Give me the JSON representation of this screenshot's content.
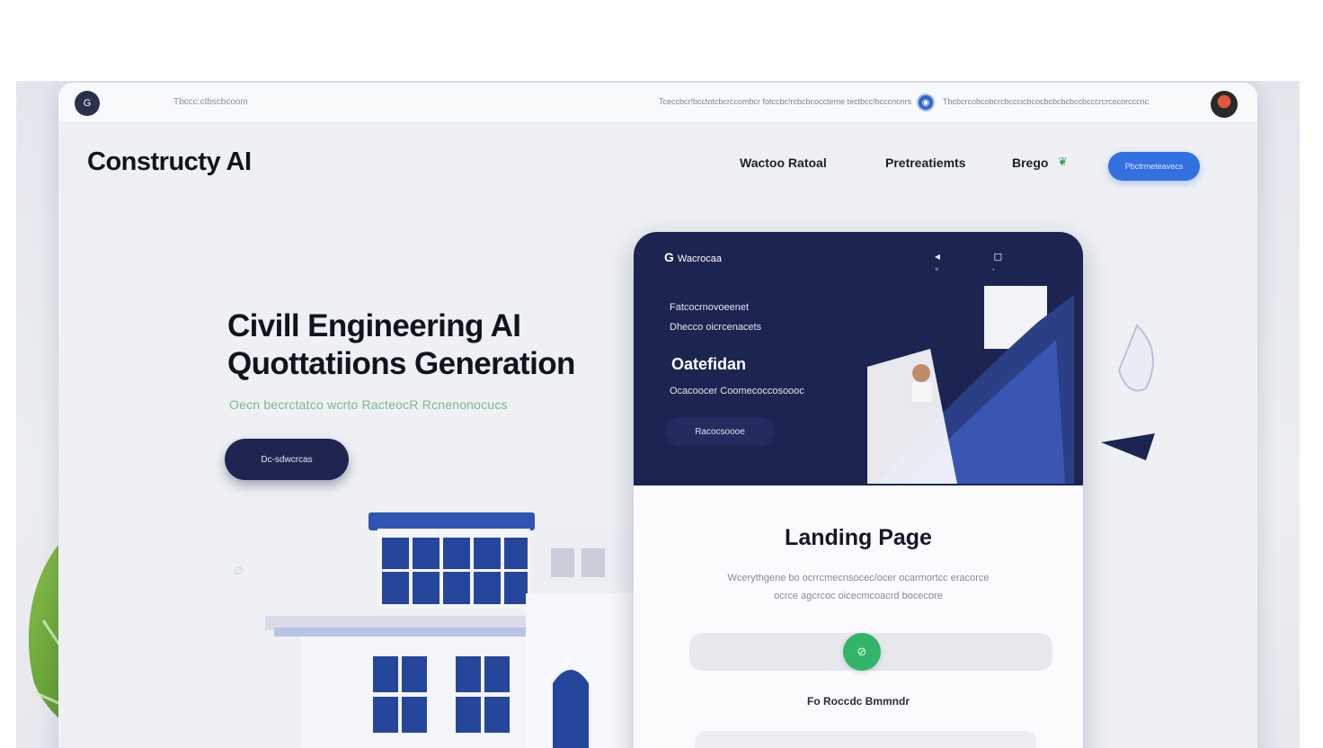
{
  "browser": {
    "logo_glyph": "G",
    "address": "Tbccc:ctbscbcoom",
    "url_left": "Tceccbcr!bcctotcbcrccombcr fotccbc!rcbcbcoccteme tectbcc!bcccncnrs",
    "url_right": "Tbcbcrcobcobcrcbcccicbcocbcbcbcbccbcccrcrcocorcccnc"
  },
  "header": {
    "brand": "Constructy AI",
    "nav": [
      "Wactoo Ratoal",
      "Pretreatiemts",
      "Brego"
    ],
    "cta": "Pbctrmeteavecs"
  },
  "hero": {
    "title_line1": "Civill Engineering AI",
    "title_line2": "Quottatiions Generation",
    "subtitle": "Oecn becrctatco wcrto RacteocR Rcnenonocucs",
    "cta": "Dc-sdwcrcas"
  },
  "phone": {
    "logo_glyph": "G",
    "logo_text": "Wacrocaa",
    "top_icons": "◂ ◻ ◦ ∙",
    "line1": "Fatcocrnovoeenet",
    "line2": "Dhecco oicrcenacets",
    "heading": "Oatefidan",
    "line3": "Ocacoocer Coomecoccosoooc",
    "button": "Racocsoooe",
    "landing_title": "Landing Page",
    "landing_desc_line1": "Wcerythgene bo ocrrcmecnsocec/ocer ocarmortcc eracorce",
    "landing_desc_line2": "ocrce agcrcoc oicecmcoacrd bocecore",
    "toggle_glyph": "⊘",
    "landing_label": "Fo Roccdc Bmmndr"
  },
  "colors": {
    "navy": "#1c2452",
    "accent_blue": "#3370e0",
    "accent_green": "#32b56a",
    "subtitle_green": "#7db98b"
  },
  "decor": {
    "watermark": "∅"
  }
}
